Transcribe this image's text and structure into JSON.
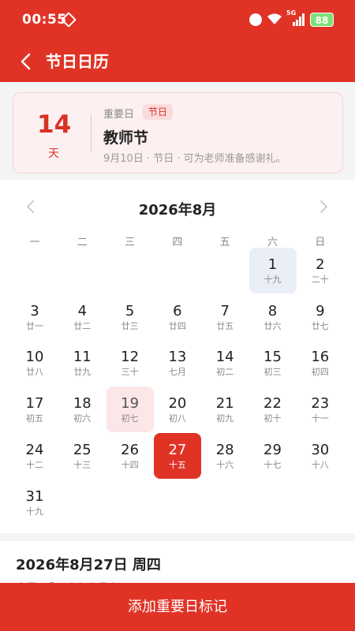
{
  "status": {
    "time": "00:55",
    "network": "5G",
    "battery": "88"
  },
  "nav": {
    "title": "节日日历"
  },
  "card": {
    "days": "14",
    "days_unit": "天",
    "category": "重要日",
    "badge": "节日",
    "name": "教师节",
    "description": "9月10日 · 节日 · 可为老师准备感谢礼。"
  },
  "calendar": {
    "month_title": "2026年8月",
    "weekdays": [
      "一",
      "二",
      "三",
      "四",
      "五",
      "六",
      "日"
    ],
    "days": [
      {
        "d": "1",
        "l": "十九",
        "state": "today"
      },
      {
        "d": "2",
        "l": "二十"
      },
      {
        "d": "3",
        "l": "廿一"
      },
      {
        "d": "4",
        "l": "廿二"
      },
      {
        "d": "5",
        "l": "廿三"
      },
      {
        "d": "6",
        "l": "廿四"
      },
      {
        "d": "7",
        "l": "廿五"
      },
      {
        "d": "8",
        "l": "廿六"
      },
      {
        "d": "9",
        "l": "廿七"
      },
      {
        "d": "10",
        "l": "廿八"
      },
      {
        "d": "11",
        "l": "廿九"
      },
      {
        "d": "12",
        "l": "三十"
      },
      {
        "d": "13",
        "l": "七月"
      },
      {
        "d": "14",
        "l": "初二"
      },
      {
        "d": "15",
        "l": "初三"
      },
      {
        "d": "16",
        "l": "初四"
      },
      {
        "d": "17",
        "l": "初五"
      },
      {
        "d": "18",
        "l": "初六"
      },
      {
        "d": "19",
        "l": "初七",
        "state": "holiday"
      },
      {
        "d": "20",
        "l": "初八"
      },
      {
        "d": "21",
        "l": "初九"
      },
      {
        "d": "22",
        "l": "初十"
      },
      {
        "d": "23",
        "l": "十一"
      },
      {
        "d": "24",
        "l": "十二"
      },
      {
        "d": "25",
        "l": "十三"
      },
      {
        "d": "26",
        "l": "十四"
      },
      {
        "d": "27",
        "l": "十五",
        "state": "selected"
      },
      {
        "d": "28",
        "l": "十六"
      },
      {
        "d": "29",
        "l": "十七"
      },
      {
        "d": "30",
        "l": "十八"
      },
      {
        "d": "31",
        "l": "十九"
      }
    ]
  },
  "detail": {
    "date": "2026年8月27日 周四",
    "lunar": "农历二〇二六年七月十五"
  },
  "button": {
    "label": "添加重要日标记"
  },
  "colors": {
    "primary": "#e03326",
    "today_bg": "#e9eef7",
    "holiday_bg": "#fbe6e8"
  }
}
